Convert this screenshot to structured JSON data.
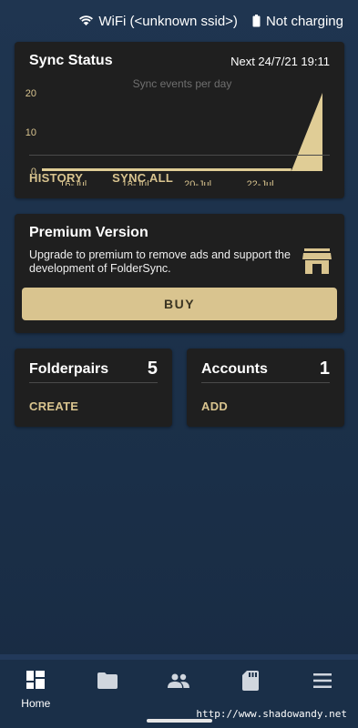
{
  "statusbar": {
    "wifi_text": "WiFi (<unknown ssid>)",
    "battery_text": "Not charging"
  },
  "sync": {
    "title": "Sync Status",
    "next": "Next 24/7/21 19:11",
    "history_label": "HISTORY",
    "sync_all_label": "SYNC ALL"
  },
  "chart_data": {
    "type": "area",
    "title": "Sync events per day",
    "x_ticks": [
      "16-Jul",
      "18-Jul",
      "20-Jul",
      "22-Jul"
    ],
    "y_ticks": [
      "20",
      "10",
      "0"
    ],
    "ylim": [
      0,
      20
    ],
    "x": [
      "15-Jul",
      "16-Jul",
      "17-Jul",
      "18-Jul",
      "19-Jul",
      "20-Jul",
      "21-Jul",
      "22-Jul",
      "23-Jul",
      "24-Jul"
    ],
    "values": [
      0,
      0,
      0,
      0,
      0,
      0,
      0,
      0,
      0,
      20
    ],
    "color": "#e0cd96"
  },
  "premium": {
    "title": "Premium Version",
    "text": "Upgrade to premium to remove ads and support the development of FolderSync.",
    "buy_label": "BUY",
    "icon": "store-icon"
  },
  "folderpairs": {
    "title": "Folderpairs",
    "count": "5",
    "action": "CREATE"
  },
  "accounts": {
    "title": "Accounts",
    "count": "1",
    "action": "ADD"
  },
  "nav": {
    "home_label": "Home",
    "items": [
      "home-icon",
      "folder-icon",
      "people-icon",
      "sd-card-icon",
      "menu-icon"
    ]
  },
  "watermark": "http://www.shadowandy.net",
  "colors": {
    "accent": "#d9c48f",
    "card": "#1f1f1f",
    "background": "#1b3049"
  }
}
